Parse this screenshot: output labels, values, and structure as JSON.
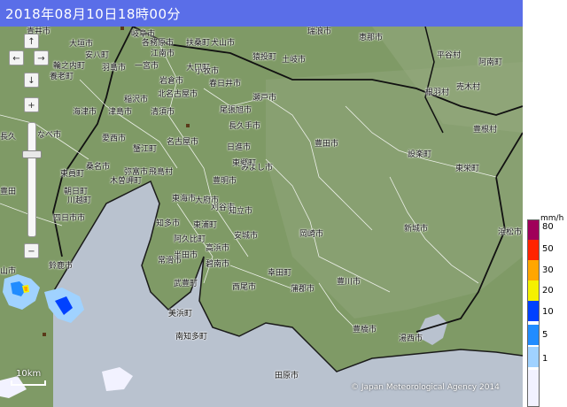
{
  "header": {
    "title": "2018年08月10日18時00分"
  },
  "map": {
    "cities": [
      "青井市",
      "岐阜市",
      "各務原市",
      "扶桑町",
      "犬山市",
      "猿投町",
      "瑞浪市",
      "恵那市",
      "大垣市",
      "安八町",
      "江南市",
      "輪之内町",
      "羽島市",
      "一宮市",
      "岩倉市",
      "大口町",
      "小牧市",
      "春日井市",
      "土岐市",
      "豊田市",
      "平谷村",
      "養老町",
      "稲沢市",
      "北名古屋市",
      "津島市",
      "清須市",
      "尾張旭市",
      "長久手市",
      "瀬戸市",
      "根羽村",
      "売木村",
      "阿南町",
      "海津市",
      "愛西市",
      "蟹江町",
      "名古屋市",
      "日進市",
      "東郷町",
      "みよし市",
      "設楽町",
      "東栄町",
      "豊根村",
      "なべ市",
      "桑名市",
      "木曽岬町",
      "弥富市",
      "飛島村",
      "東海市",
      "大府市",
      "刈谷市",
      "知立市",
      "豊明市",
      "岡崎市",
      "新城市",
      "浜松市",
      "東員町",
      "朝日町",
      "川越町",
      "四日市市",
      "知多市",
      "東浦町",
      "阿久比町",
      "安城市",
      "碧南市",
      "高浜市",
      "半田市",
      "常滑市",
      "西尾市",
      "幸田町",
      "蒲郡市",
      "豊川市",
      "豊橋市",
      "湯西市",
      "田原市",
      "武豊町",
      "美浜町",
      "南知多町",
      "鈴鹿市",
      "山市",
      "豊田",
      "長久"
    ],
    "controls": {
      "up": "↑",
      "left": "←",
      "right": "→",
      "down": "↓",
      "zoom_in": "+",
      "zoom_out": "−"
    },
    "scale_label": "10km",
    "copyright": "© Japan Meteorological Agency 2014"
  },
  "legend": {
    "unit": "mm/h",
    "levels": [
      {
        "label": "80",
        "color": "#a0005a"
      },
      {
        "label": "50",
        "color": "#ff2400"
      },
      {
        "label": "30",
        "color": "#ffa600"
      },
      {
        "label": "20",
        "color": "#f5f100"
      },
      {
        "label": "10",
        "color": "#0041ff"
      },
      {
        "label": "5",
        "color": "#218cff"
      },
      {
        "label": "1",
        "color": "#a0d2ff"
      },
      {
        "label": "",
        "color": "#f2f2ff"
      }
    ]
  }
}
